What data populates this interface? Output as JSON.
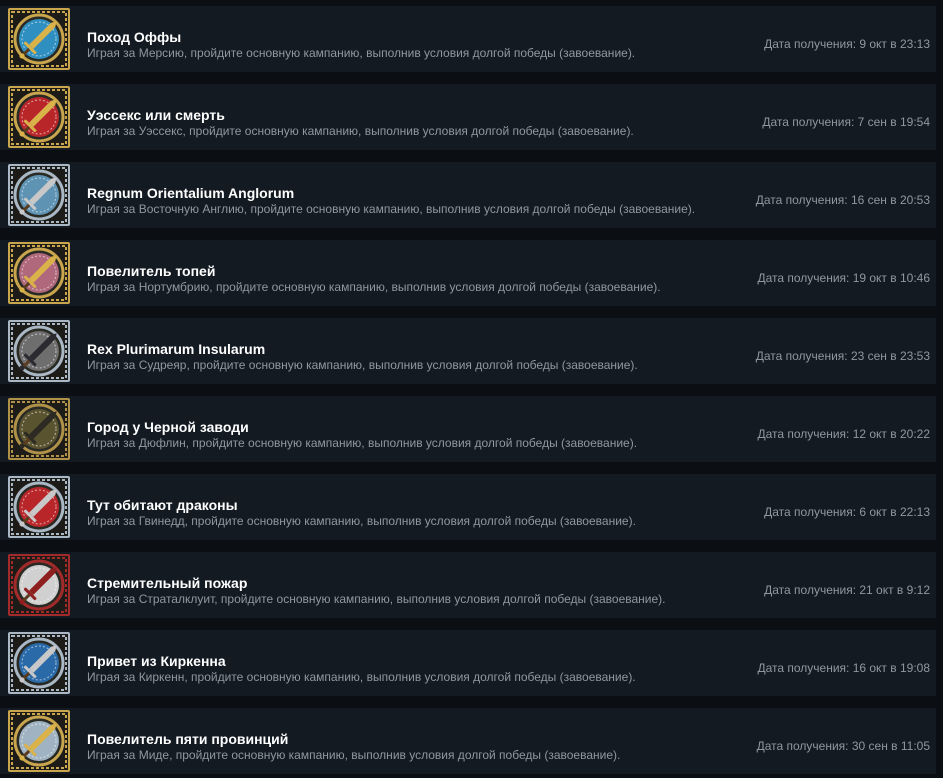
{
  "achievements": [
    {
      "title": "Поход Оффы",
      "description": "Играя за Мерсию, пройдите основную кампанию, выполнив условия долгой победы (завоевание).",
      "date": "Дата получения: 9 окт в 23:13",
      "icon": "sword-emblem-icon",
      "emblem_color": "#2f8fc0",
      "frame_color": "#c9a64d",
      "sword_color": "#d9b24a"
    },
    {
      "title": "Уэссекс или смерть",
      "description": "Играя за Уэссекс, пройдите основную кампанию, выполнив условия долгой победы (завоевание).",
      "date": "Дата получения: 7 сен в 19:54",
      "icon": "sword-emblem-icon",
      "emblem_color": "#b8262a",
      "frame_color": "#c9a64d",
      "sword_color": "#d9b24a"
    },
    {
      "title": "Regnum Orientalium Anglorum",
      "description": "Играя за Восточную Англию, пройдите основную кампанию, выполнив условия долгой победы (завоевание).",
      "date": "Дата получения: 16 сен в 20:53",
      "icon": "sword-emblem-icon",
      "emblem_color": "#5e93b4",
      "frame_color": "#a9b8c4",
      "sword_color": "#c8c8c8"
    },
    {
      "title": "Повелитель топей",
      "description": "Играя за Нортумбрию, пройдите основную кампанию, выполнив условия долгой победы (завоевание).",
      "date": "Дата получения: 19 окт в 10:46",
      "icon": "sword-emblem-icon",
      "emblem_color": "#b0687c",
      "frame_color": "#c9a64d",
      "sword_color": "#d9b24a"
    },
    {
      "title": "Rex Plurimarum Insularum",
      "description": "Играя за Судреяр, пройдите основную кампанию, выполнив условия долгой победы (завоевание).",
      "date": "Дата получения: 23 сен в 23:53",
      "icon": "sword-emblem-icon",
      "emblem_color": "#6e6e6e",
      "frame_color": "#a9b8c4",
      "sword_color": "#2a2a30"
    },
    {
      "title": "Город у Черной заводи",
      "description": "Играя за Дюфлин, пройдите основную кампанию, выполнив условия долгой победы (завоевание).",
      "date": "Дата получения: 12 окт в 20:22",
      "icon": "sword-emblem-icon",
      "emblem_color": "#5a5330",
      "frame_color": "#b09148",
      "sword_color": "#2c2a22"
    },
    {
      "title": "Тут обитают драконы",
      "description": "Играя за Гвинедд, пройдите основную кампанию, выполнив условия долгой победы (завоевание).",
      "date": "Дата получения: 6 окт в 22:13",
      "icon": "sword-emblem-icon",
      "emblem_color": "#b8262a",
      "frame_color": "#a9b8c4",
      "sword_color": "#c8c8c8"
    },
    {
      "title": "Стремительный пожар",
      "description": "Играя за Страталклуит, пройдите основную кампанию, выполнив условия долгой победы (завоевание).",
      "date": "Дата получения: 21 окт в 9:12",
      "icon": "sword-emblem-icon",
      "emblem_color": "#d0d0d0",
      "frame_color": "#a32a2a",
      "sword_color": "#8e1f1f"
    },
    {
      "title": "Привет из Киркенна",
      "description": "Играя за Киркенн, пройдите основную кампанию, выполнив условия долгой победы (завоевание).",
      "date": "Дата получения: 16 окт в 19:08",
      "icon": "sword-emblem-icon",
      "emblem_color": "#2a6aa8",
      "frame_color": "#a9b8c4",
      "sword_color": "#c8c8c8"
    },
    {
      "title": "Повелитель пяти провинций",
      "description": "Играя за Миде, пройдите основную кампанию, выполнив условия долгой победы (завоевание).",
      "date": "Дата получения: 30 сен в 11:05",
      "icon": "sword-emblem-icon",
      "emblem_color": "#9fb3c2",
      "frame_color": "#c9a64d",
      "sword_color": "#d9b24a"
    }
  ]
}
